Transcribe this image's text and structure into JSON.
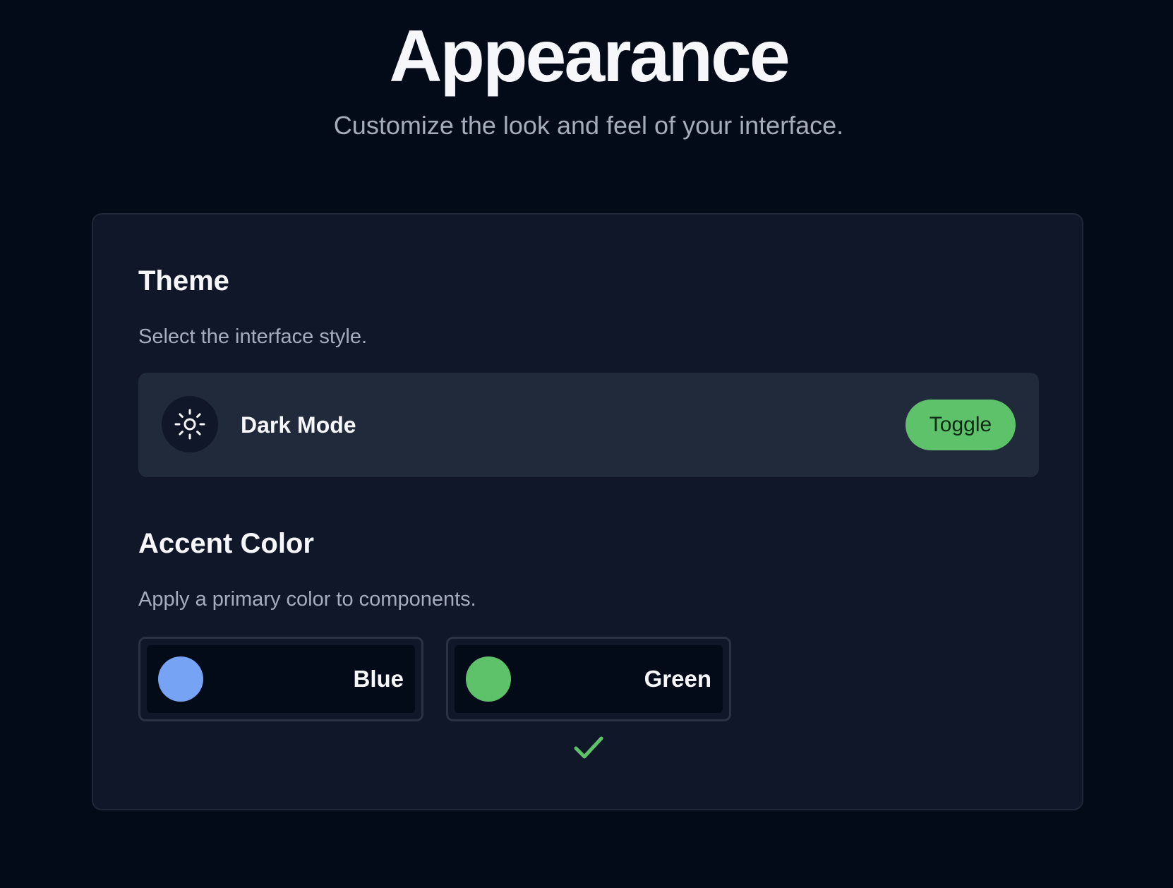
{
  "header": {
    "title": "Appearance",
    "subtitle": "Customize the look and feel of your interface."
  },
  "theme": {
    "heading": "Theme",
    "description": "Select the interface style.",
    "row_icon": "sun-icon",
    "row_label": "Dark Mode",
    "toggle_label": "Toggle"
  },
  "accent": {
    "heading": "Accent Color",
    "description": "Apply a primary color to components.",
    "options": [
      {
        "label": "Blue",
        "color": "#76a3f4",
        "selected": false
      },
      {
        "label": "Green",
        "color": "#5ec26a",
        "selected": true
      }
    ],
    "selected_indicator_icon": "check-icon"
  },
  "colors": {
    "background": "#030a18",
    "card": "#101728",
    "row": "#202a3b",
    "accent_green": "#5ec26a",
    "accent_blue": "#76a3f4"
  }
}
